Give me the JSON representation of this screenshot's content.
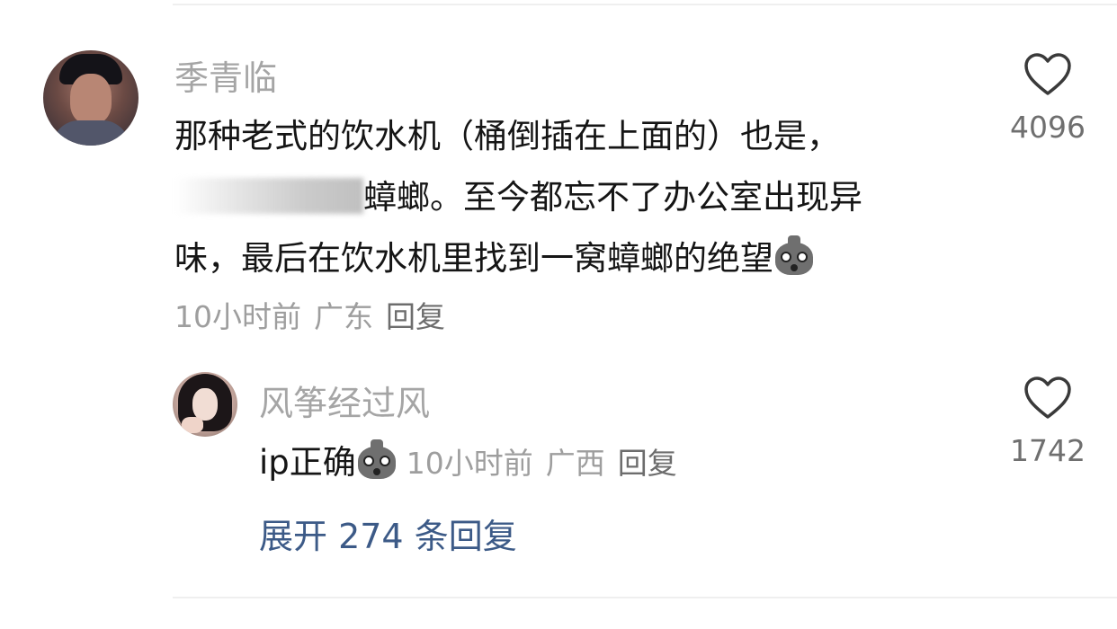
{
  "comment": {
    "username": "季青临",
    "text_lines": [
      "那种老式的饮水机（桶倒插在上面的）也是，",
      "蟑螂。至今都忘不了办公室出现异",
      "味，最后在饮水机里找到一窝蟑螂的绝望"
    ],
    "time": "10小时前",
    "location": "广东",
    "reply_label": "回复",
    "like_count": "4096"
  },
  "reply": {
    "username": "风筝经过风",
    "text": "ip正确",
    "time": "10小时前",
    "location": "广西",
    "reply_label": "回复",
    "like_count": "1742"
  },
  "expand_label": "展开 274 条回复",
  "icons": {
    "like": "heart-outline-icon",
    "emoji": "sweating-bag-emoji"
  },
  "colors": {
    "username": "#a5a5a5",
    "text": "#151515",
    "meta": "#9e9e9e",
    "expand_link": "#3c5a87"
  }
}
